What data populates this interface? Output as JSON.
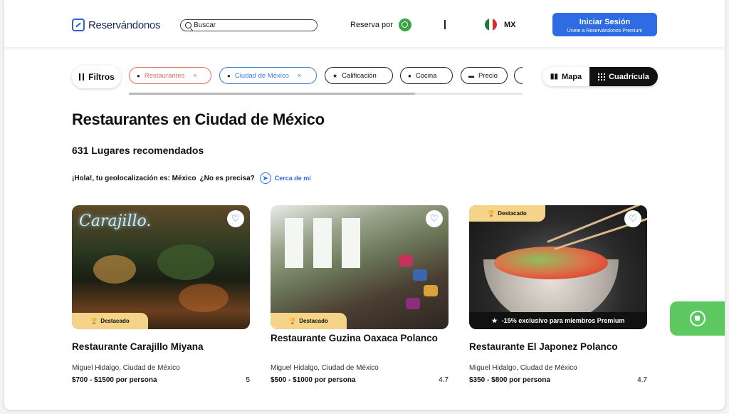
{
  "header": {
    "logo_text": "Reservándonos",
    "search_placeholder": "Buscar",
    "reserva_label": "Reserva por",
    "country_code": "MX",
    "login_title": "Iniciar Sesión",
    "login_subtitle": "Únete a Reservándonos Premium"
  },
  "filters": {
    "button_label": "Filtros",
    "chips": [
      {
        "label": "Restaurantes",
        "icon": "tag-icon",
        "removable": true
      },
      {
        "label": "Ciudad de México",
        "icon": "pin-icon",
        "removable": true
      },
      {
        "label": "Calificación",
        "icon": "star-icon"
      },
      {
        "label": "Cocina",
        "icon": "chef-hat-icon"
      },
      {
        "label": "Precio",
        "icon": "money-icon"
      }
    ],
    "remove_symbol": "×",
    "view_map": "Mapa",
    "view_grid": "Cuadrícula"
  },
  "main": {
    "title": "Restaurantes en Ciudad de México",
    "count": "631 Lugares recomendados",
    "geo_text": "¡Hola!, tu geolocalización es: México",
    "geo_question": "¿No es precisa?",
    "nearby": "Cerca de mí"
  },
  "cards": [
    {
      "name": "Restaurante Carajillo Miyana",
      "location": "Miguel Hidalgo, Ciudad de México",
      "price": "$700 - $1500 por persona",
      "rating": "5",
      "badge": "Destacado",
      "image_sign": "Carajillo."
    },
    {
      "name": "Restaurante Guzina Oaxaca Polanco",
      "location": "Miguel Hidalgo, Ciudad de México",
      "price": "$500 - $1000 por persona",
      "rating": "4.7",
      "badge": "Destacado"
    },
    {
      "name": "Restaurante El Japonez Polanco",
      "location": "Miguel Hidalgo, Ciudad de México",
      "price": "$350 - $800 por persona",
      "rating": "4.7",
      "badge": "Destacado",
      "promo": "-15% exclusivo para miembros Premium"
    }
  ],
  "colors": {
    "accent": "#2f6be3",
    "badge": "#f5d389",
    "whatsapp": "#5bc95f",
    "chip_restaurant": "#e26b5d"
  }
}
